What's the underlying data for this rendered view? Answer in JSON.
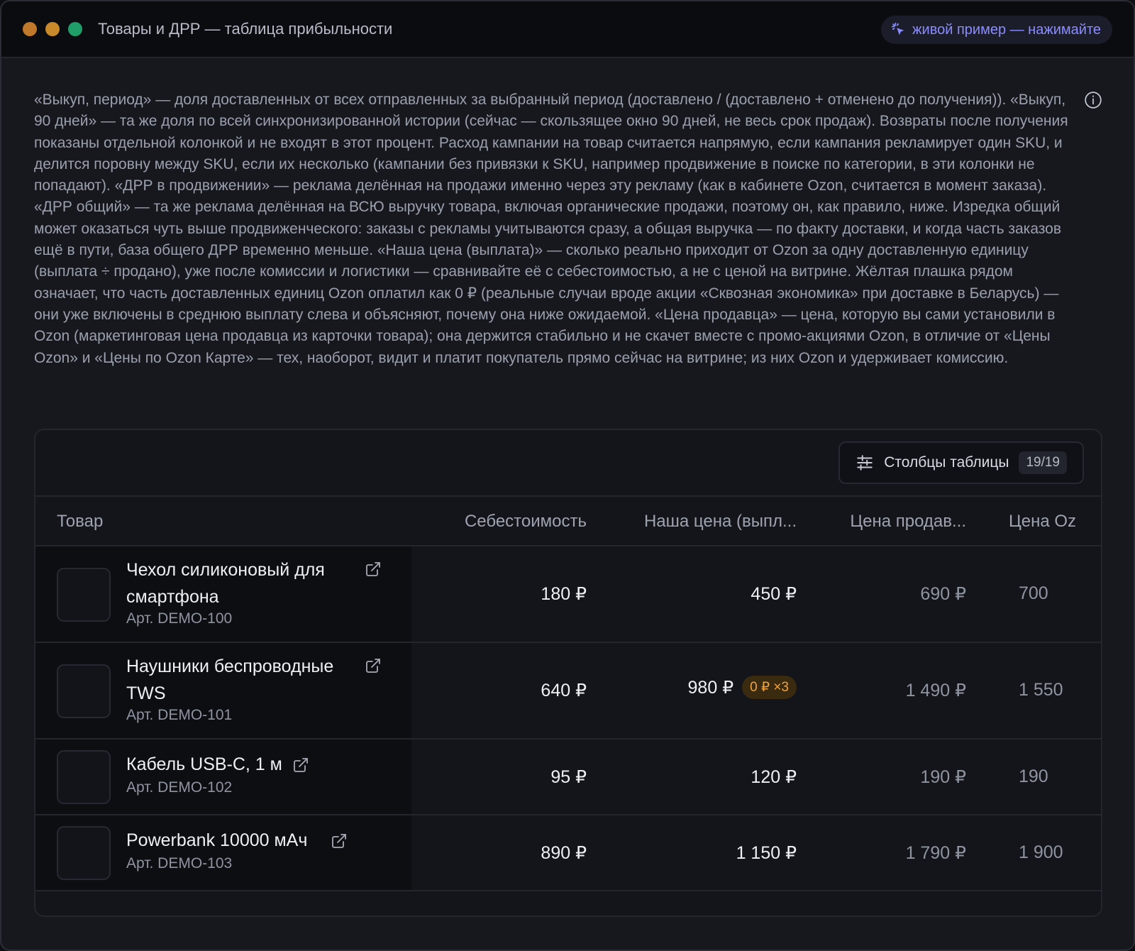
{
  "window": {
    "title": "Товары и ДРР — таблица прибыльности",
    "dot_colors": [
      "#c0792b",
      "#c98a2c",
      "#1f9e6a"
    ],
    "live_label": "живой пример — нажимайте"
  },
  "description": "«Выкуп, период» — доля доставленных от всех отправленных за выбранный период (доставлено / (доставлено + отменено до получения)). «Выкуп, 90 дней» — та же доля по всей синхронизированной истории (сейчас — скользящее окно 90 дней, не весь срок продаж). Возвраты после получения показаны отдельной колонкой и не входят в этот процент. Расход кампании на товар считается напрямую, если кампания рекламирует один SKU, и делится поровну между SKU, если их несколько (кампании без привязки к SKU, например продвижение в поиске по категории, в эти колонки не попадают). «ДРР в продвижении» — реклама делённая на продажи именно через эту рекламу (как в кабинете Ozon, считается в момент заказа). «ДРР общий» — та же реклама делённая на ВСЮ выручку товара, включая органические продажи, поэтому он, как правило, ниже. Изредка общий может оказаться чуть выше продвиженческого: заказы с рекламы учитываются сразу, а общая выручка — по факту доставки, и когда часть заказов ещё в пути, база общего ДРР временно меньше. «Наша цена (выплата)» — сколько реально приходит от Ozon за одну доставленную единицу (выплата ÷ продано), уже после комиссии и логистики — сравнивайте её с себестоимостью, а не с ценой на витрине. Жёлтая плашка рядом означает, что часть доставленных единиц Ozon оплатил как 0 ₽ (реальные случаи вроде акции «Сквозная экономика» при доставке в Беларусь) — они уже включены в среднюю выплату слева и объясняют, почему она ниже ожидаемой. «Цена продавца» — цена, которую вы сами установили в Ozon (маркетинговая цена продавца из карточки товара); она держится стабильно и не скачет вместе с промо-акциями Ozon, в отличие от «Цены Ozon» и «Цены по Ozon Карте» — тех, наоборот, видит и платит покупатель прямо сейчас на витрине; из них Ozon и удерживает комиссию.",
  "toolbar": {
    "columns_label": "Столбцы таблицы",
    "columns_count": "19/19"
  },
  "table": {
    "headers": {
      "product": "Товар",
      "cost": "Себестоимость",
      "our_price": "Наша цена (выпл...",
      "seller_price": "Цена продав...",
      "ozon_price": "Цена Oz"
    },
    "rows": [
      {
        "name_l1": "Чехол силиконовый для",
        "name_l2": "смартфона",
        "sku": "Арт. DEMO-100",
        "cost": "180 ₽",
        "our_price": "450 ₽",
        "badge": "",
        "seller_price": "690 ₽",
        "ozon_price": "700"
      },
      {
        "name_l1": "Наушники беспроводные",
        "name_l2": "TWS",
        "sku": "Арт. DEMO-101",
        "cost": "640 ₽",
        "our_price": "980 ₽",
        "badge": "0 ₽ ×3",
        "seller_price": "1 490 ₽",
        "ozon_price": "1 550"
      },
      {
        "name_l1": "Кабель USB-C, 1 м",
        "name_l2": "",
        "sku": "Арт. DEMO-102",
        "cost": "95 ₽",
        "our_price": "120 ₽",
        "badge": "",
        "seller_price": "190 ₽",
        "ozon_price": "190"
      },
      {
        "name_l1": "Powerbank 10000 мАч",
        "name_l2": "",
        "sku": "Арт. DEMO-103",
        "cost": "890 ₽",
        "our_price": "1 150 ₽",
        "badge": "",
        "seller_price": "1 790 ₽",
        "ozon_price": "1 900"
      }
    ]
  }
}
